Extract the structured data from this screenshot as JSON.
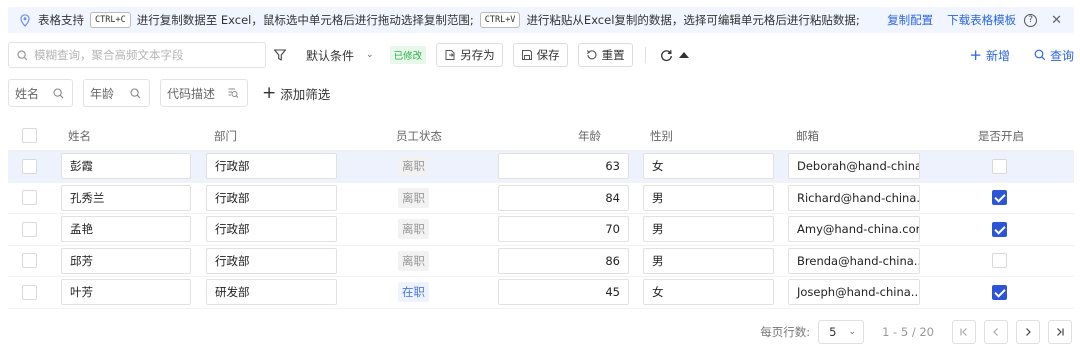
{
  "tip": {
    "text_1": "表格支持",
    "key_copy": "CTRL+C",
    "text_2": "进行复制数据至 Excel，鼠标选中单元格后进行拖动选择复制范围;",
    "key_paste": "CTRL+V",
    "text_3": "进行粘贴从Excel复制的数据，选择可编辑单元格后进行粘贴数据;",
    "copy_config": "复制配置",
    "download_template": "下载表格模板",
    "help_glyph": "?",
    "close_glyph": "✕"
  },
  "toolbar": {
    "search_placeholder": "模糊查询，聚合高频文本字段",
    "default_condition": "默认条件",
    "modified_badge": "已修改",
    "save_as": "另存为",
    "save": "保存",
    "reset": "重置",
    "add_new": "新增",
    "query": "查询"
  },
  "filters": {
    "name": "姓名",
    "age": "年龄",
    "code_desc": "代码描述",
    "add_filter": "添加筛选"
  },
  "columns": {
    "name": "姓名",
    "dept": "部门",
    "status": "员工状态",
    "age": "年龄",
    "gender": "性别",
    "email": "邮箱",
    "enabled": "是否开启"
  },
  "rows": [
    {
      "name": "彭霞",
      "dept": "行政部",
      "status": "离职",
      "age": "63",
      "gender": "女",
      "email": "Deborah@hand-china....",
      "enabled": false
    },
    {
      "name": "孔秀兰",
      "dept": "行政部",
      "status": "离职",
      "age": "84",
      "gender": "男",
      "email": "Richard@hand-china....",
      "enabled": true
    },
    {
      "name": "孟艳",
      "dept": "行政部",
      "status": "离职",
      "age": "70",
      "gender": "男",
      "email": "Amy@hand-china.com",
      "enabled": true
    },
    {
      "name": "邱芳",
      "dept": "行政部",
      "status": "离职",
      "age": "86",
      "gender": "男",
      "email": "Brenda@hand-china....",
      "enabled": false
    },
    {
      "name": "叶芳",
      "dept": "研发部",
      "status": "在职",
      "age": "45",
      "gender": "女",
      "email": "Joseph@hand-china....",
      "enabled": true
    }
  ],
  "pagination": {
    "page_size_label": "每页行数:",
    "page_size": "5",
    "range": "1 - 5 / 20"
  },
  "colors": {
    "accent": "#2b65e6",
    "checkbox_on": "#2b55d6",
    "highlight_row": "#eef2fd",
    "modified_green": "#2fae4e"
  }
}
